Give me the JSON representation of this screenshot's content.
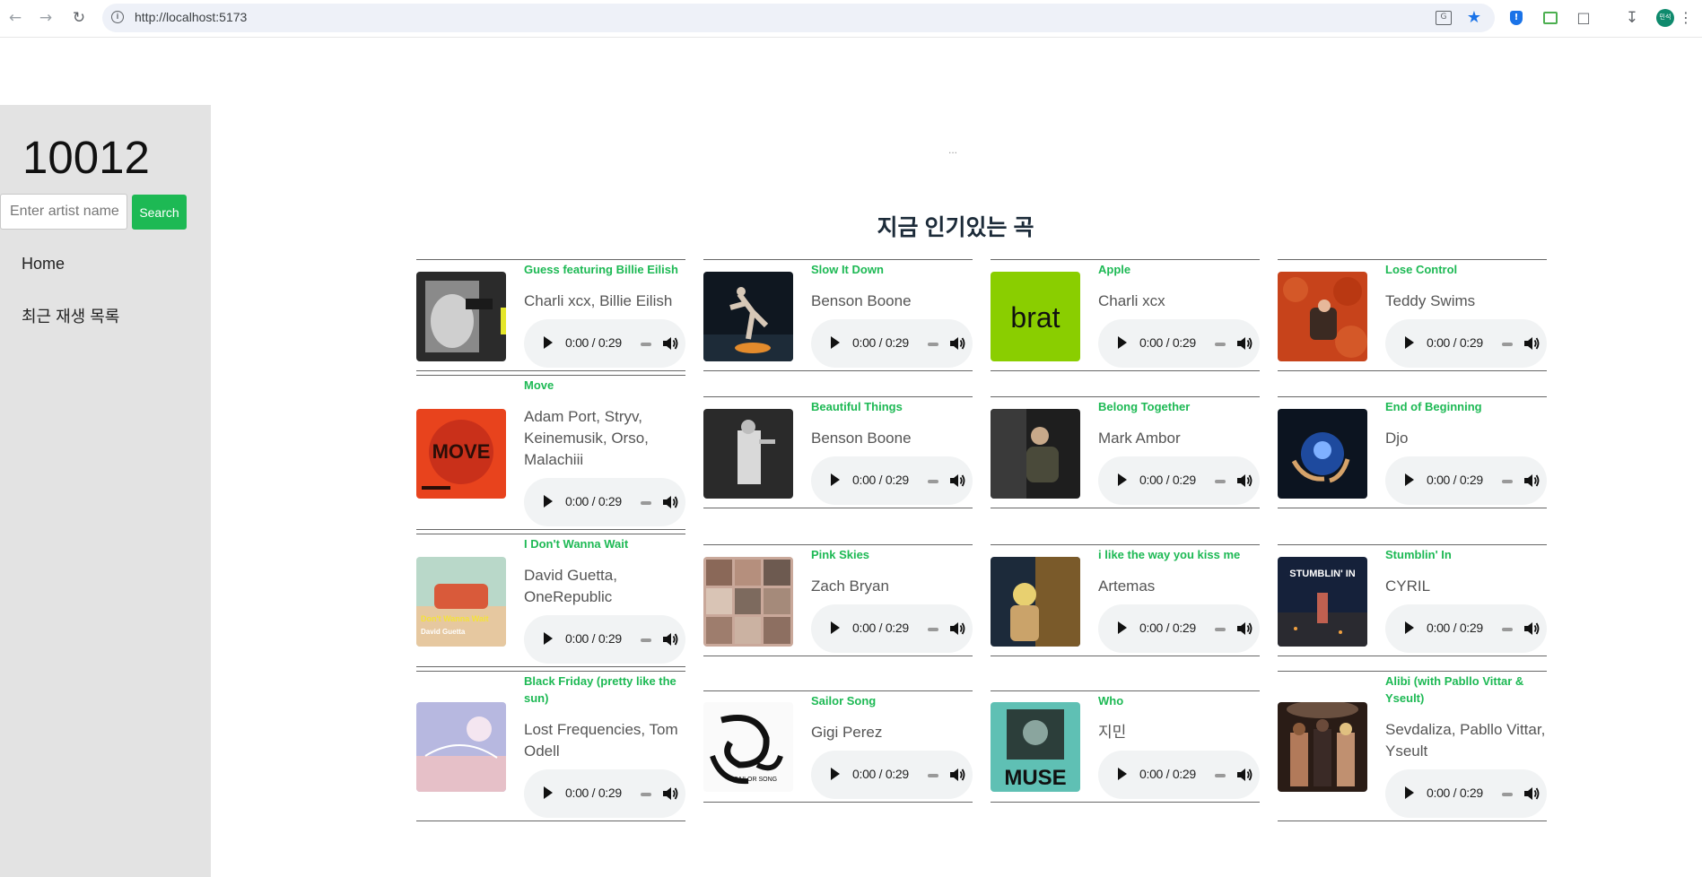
{
  "browser": {
    "url": "http://localhost:5173",
    "profile_initials": "민석"
  },
  "sidebar": {
    "brand": "10012",
    "search_placeholder": "Enter artist name",
    "search_button": "Search",
    "nav": [
      {
        "label": "Home"
      },
      {
        "label": "최근 재생 목록"
      }
    ]
  },
  "main": {
    "loading_indicator": "...",
    "section_title": "지금 인기있는 곡",
    "tracks": [
      {
        "title": "Guess featuring Billie Eilish",
        "artist": "Charli xcx, Billie Eilish",
        "time": "0:00 / 0:29",
        "cover": "bw-photo"
      },
      {
        "title": "Slow It Down",
        "artist": "Benson Boone",
        "time": "0:00 / 0:29",
        "cover": "night-skate"
      },
      {
        "title": "Apple",
        "artist": "Charli xcx",
        "time": "0:00 / 0:29",
        "cover": "brat",
        "cover_text": "brat"
      },
      {
        "title": "Lose Control",
        "artist": "Teddy Swims",
        "time": "0:00 / 0:29",
        "cover": "orange-room"
      },
      {
        "title": "Move",
        "artist": "Adam Port, Stryv, Keinemusik, Orso, Malachiii",
        "time": "0:00 / 0:29",
        "cover": "move",
        "cover_text": "MOVE"
      },
      {
        "title": "Beautiful Things",
        "artist": "Benson Boone",
        "time": "0:00 / 0:29",
        "cover": "stage-bw"
      },
      {
        "title": "Belong Together",
        "artist": "Mark Ambor",
        "time": "0:00 / 0:29",
        "cover": "dark-portrait"
      },
      {
        "title": "End of Beginning",
        "artist": "Djo",
        "time": "0:00 / 0:29",
        "cover": "blue-orb"
      },
      {
        "title": "I Don't Wanna Wait",
        "artist": "David Guetta, OneRepublic",
        "time": "0:00 / 0:29",
        "cover": "car-pastel"
      },
      {
        "title": "Pink Skies",
        "artist": "Zach Bryan",
        "time": "0:00 / 0:29",
        "cover": "photo-grid"
      },
      {
        "title": "i like the way you kiss me",
        "artist": "Artemas",
        "time": "0:00 / 0:29",
        "cover": "blonde-wall"
      },
      {
        "title": "Stumblin' In",
        "artist": "CYRIL",
        "time": "0:00 / 0:29",
        "cover": "stumblin",
        "cover_text": "STUMBLIN' IN"
      },
      {
        "title": "Black Friday (pretty like the sun)",
        "artist": "Lost Frequencies, Tom Odell",
        "time": "0:00 / 0:29",
        "cover": "pastel-sky"
      },
      {
        "title": "Sailor Song",
        "artist": "Gigi Perez",
        "time": "0:00 / 0:29",
        "cover": "octopus",
        "cover_text": "SAILOR SONG"
      },
      {
        "title": "Who",
        "artist": "지민",
        "time": "0:00 / 0:29",
        "cover": "muse",
        "cover_text": "MUSE"
      },
      {
        "title": "Alibi (with Pabllo Vittar & Yseult)",
        "artist": "Sevdaliza, Pabllo Vittar, Yseult",
        "time": "0:00 / 0:29",
        "cover": "trio"
      }
    ]
  },
  "colors": {
    "accent": "#1db954",
    "sidebar_bg": "#e3e3e3",
    "title_color": "#1c2b39",
    "player_bg": "#f1f3f4"
  },
  "icons": [
    "back-icon",
    "forward-icon",
    "reload-icon",
    "info-icon",
    "translate-icon",
    "bookmark-star-icon",
    "extension-icon",
    "download-icon",
    "menu-icon",
    "play-icon",
    "volume-icon"
  ]
}
